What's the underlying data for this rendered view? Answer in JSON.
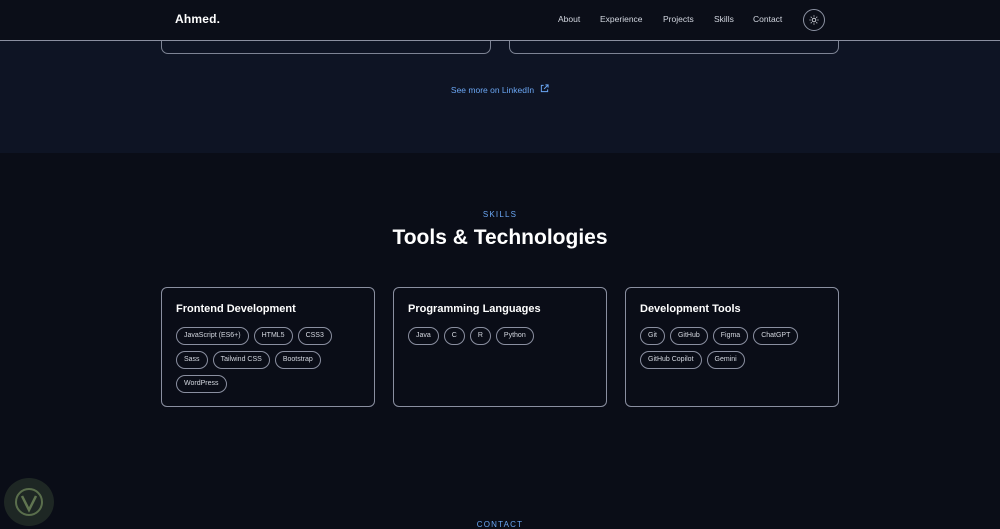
{
  "nav": {
    "brand": "Ahmed.",
    "links": [
      {
        "label": "About"
      },
      {
        "label": "Experience"
      },
      {
        "label": "Projects"
      },
      {
        "label": "Skills"
      },
      {
        "label": "Contact"
      }
    ],
    "theme_toggle_icon": "sun-icon"
  },
  "experience": {
    "linkedin_label": "See more on LinkedIn",
    "linkedin_icon": "external-link-icon"
  },
  "skills": {
    "eyebrow": "SKILLS",
    "title": "Tools & Technologies",
    "cards": [
      {
        "title": "Frontend Development",
        "tags": [
          "JavaScript (ES6+)",
          "HTML5",
          "CSS3",
          "Sass",
          "Tailwind CSS",
          "Bootstrap",
          "WordPress"
        ]
      },
      {
        "title": "Programming Languages",
        "tags": [
          "Java",
          "C",
          "R",
          "Python"
        ]
      },
      {
        "title": "Development Tools",
        "tags": [
          "Git",
          "GitHub",
          "Figma",
          "ChatGPT",
          "GitHub Copilot",
          "Gemini"
        ]
      }
    ]
  },
  "contact": {
    "eyebrow": "CONTACT"
  },
  "colors": {
    "background": "#0a0d17",
    "section_alt": "#0e1424",
    "accent": "#6aa6f3",
    "border": "#8a8fa0"
  }
}
